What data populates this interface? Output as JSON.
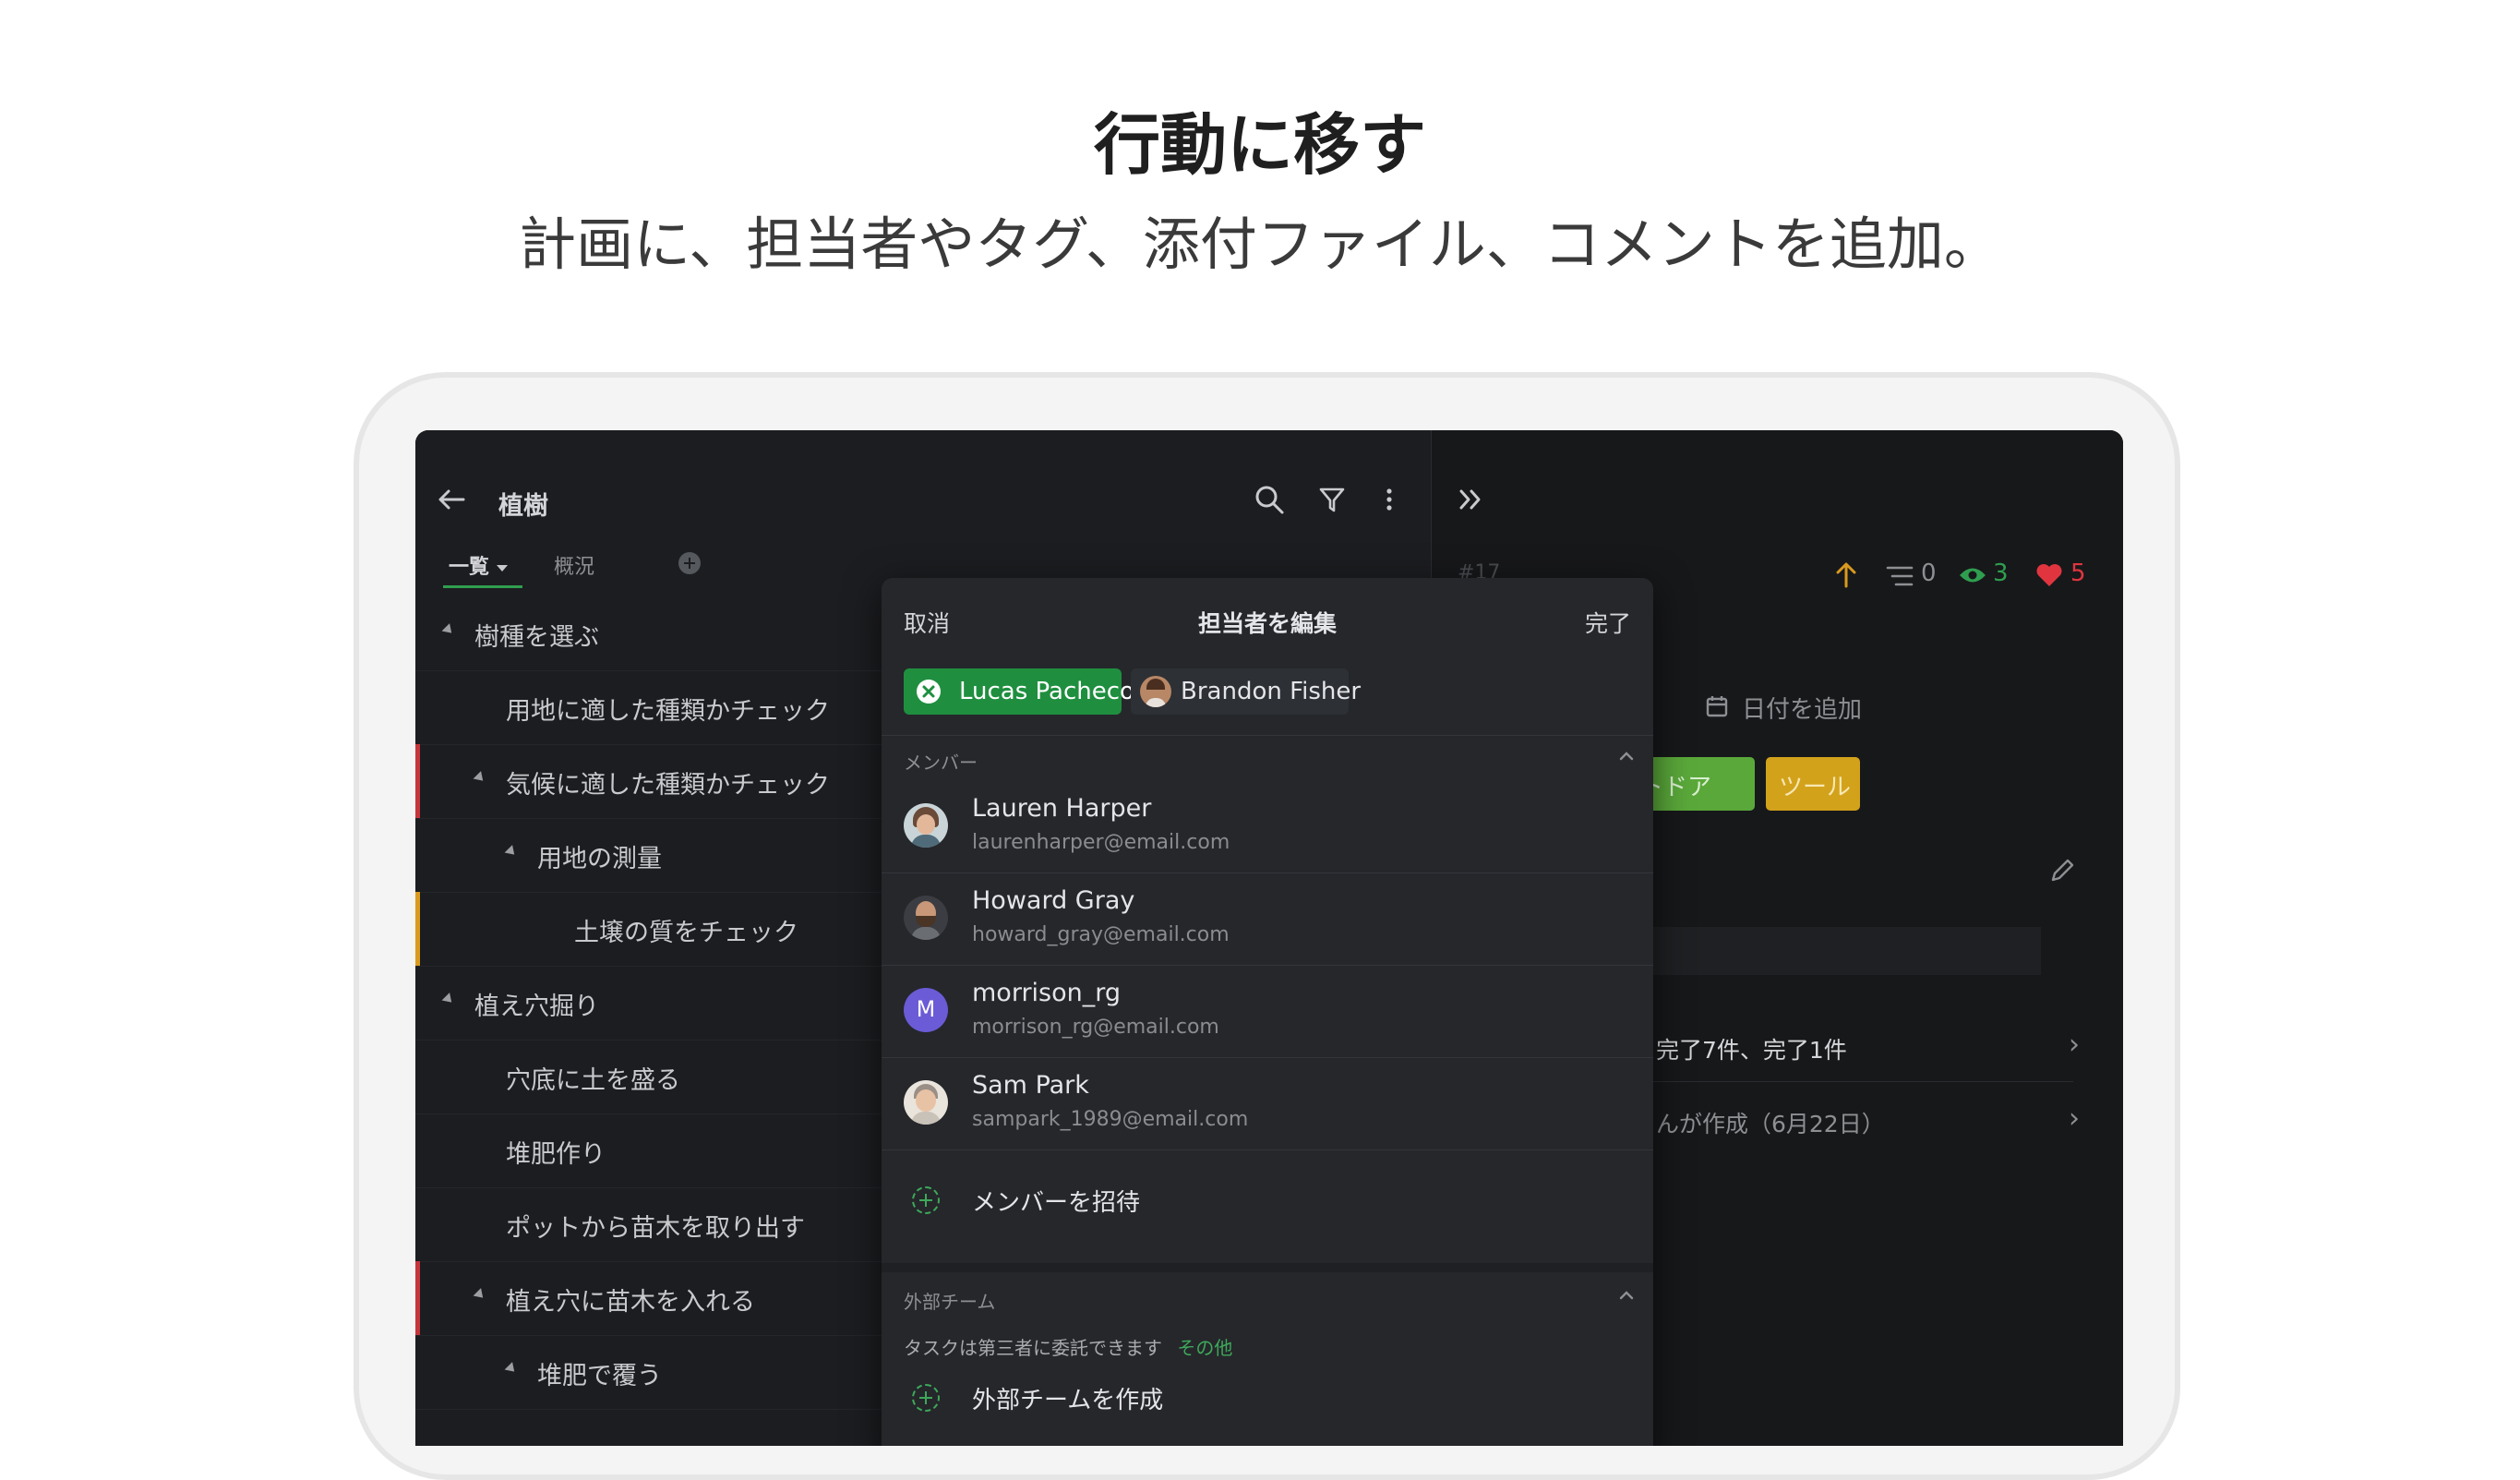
{
  "headline": "行動に移す",
  "subline": "計画に、担当者やタグ、添付ファイル、コメントを追加。",
  "left": {
    "back_icon": "arrow-left-icon",
    "project_title": "植樹",
    "tabs": {
      "list": "一覧",
      "overview": "概況"
    },
    "rows": [
      {
        "label": "樹種を選ぶ"
      },
      {
        "label": "用地に適した種類かチェック"
      },
      {
        "label": "気候に適した種類かチェック"
      },
      {
        "label": "用地の測量"
      },
      {
        "label": "土壌の質をチェック"
      },
      {
        "label": "植え穴掘り"
      },
      {
        "label": "穴底に土を盛る"
      },
      {
        "label": "堆肥作り"
      },
      {
        "label": "ポットから苗木を取り出す"
      },
      {
        "label": "植え穴に苗木を入れる"
      },
      {
        "label": "堆肥で覆う"
      }
    ]
  },
  "right": {
    "task_id": "#17",
    "comments_count": "0",
    "watchers_count": "3",
    "likes_count": "5",
    "add_date": "日付を追加",
    "tag1": "トドア",
    "tag2": "ツール",
    "subtasks_summary": "完了7件、完了1件",
    "created_by": "んが作成（6月22日）"
  },
  "modal": {
    "cancel": "取消",
    "title": "担当者を編集",
    "done": "完了",
    "selected": [
      {
        "name": "Lucas Pacheco"
      },
      {
        "name": "Brandon Fisher"
      }
    ],
    "members_header": "メンバー",
    "members": [
      {
        "name": "Lauren Harper",
        "email": "laurenharper@email.com"
      },
      {
        "name": "Howard Gray",
        "email": "howard_gray@email.com"
      },
      {
        "name": "morrison_rg",
        "email": "morrison_rg@email.com",
        "initial": "M"
      },
      {
        "name": "Sam Park",
        "email": "sampark_1989@email.com"
      }
    ],
    "invite": "メンバーを招待",
    "external_header": "外部チーム",
    "external_desc": "タスクは第三者に委託できます",
    "external_more": "その他",
    "create_external": "外部チームを作成"
  },
  "colors": {
    "accent_green": "#1f8f3f",
    "priority_orange": "#d99a1f",
    "watch_green": "#2f9e4f",
    "like_red": "#e0353f",
    "tag_green": "#5aa83a",
    "tag_orange": "#d3a21b"
  }
}
